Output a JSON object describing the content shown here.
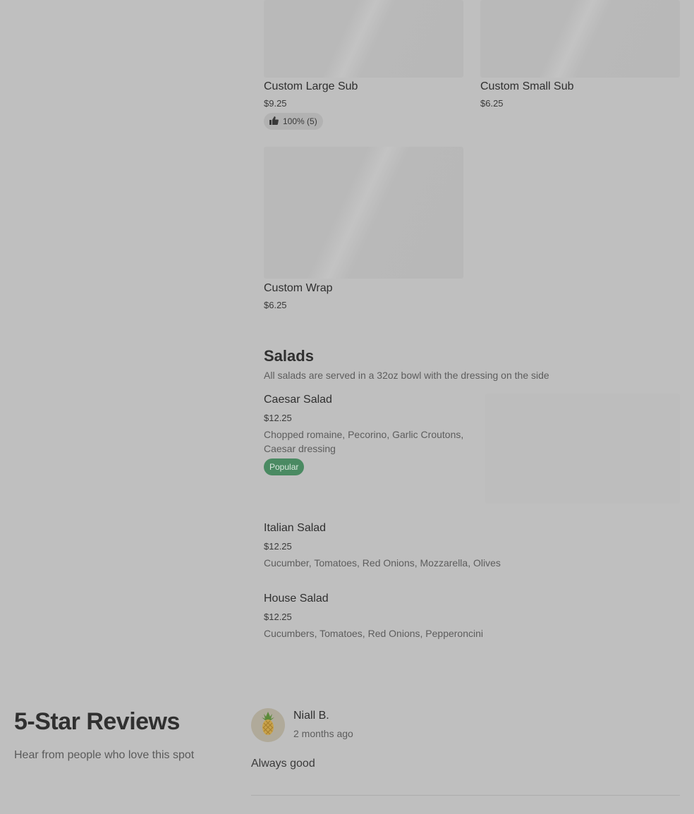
{
  "subs": {
    "large": {
      "title": "Custom Large Sub",
      "price": "$9.25",
      "rating": "100% (5)"
    },
    "small": {
      "title": "Custom Small Sub",
      "price": "$6.25"
    },
    "wrap": {
      "title": "Custom Wrap",
      "price": "$6.25"
    }
  },
  "salads": {
    "title": "Salads",
    "subtitle": "All salads are served in a 32oz bowl with the dressing on the side",
    "items": [
      {
        "title": "Caesar Salad",
        "price": "$12.25",
        "desc_line1": "Chopped romaine, Pecorino, Garlic Croutons,",
        "desc_line2": "Caesar dressing",
        "badge": "Popular"
      },
      {
        "title": "Italian Salad",
        "price": "$12.25",
        "desc": "Cucumber, Tomatoes, Red Onions, Mozzarella, Olives"
      },
      {
        "title": "House Salad",
        "price": "$12.25",
        "desc": "Cucumbers, Tomatoes, Red Onions, Pepperoncini"
      }
    ]
  },
  "reviews": {
    "title": "5-Star Reviews",
    "subtitle": "Hear from people who love this spot",
    "items": [
      {
        "name": "Niall B.",
        "time": "2 months ago",
        "text": "Always good",
        "avatar_icon": "pineapple-icon"
      }
    ]
  },
  "icons": {
    "rating": "thumbs-up-icon"
  },
  "colors": {
    "popular_badge": "#4a8a62",
    "background": "#bfbfbf"
  }
}
